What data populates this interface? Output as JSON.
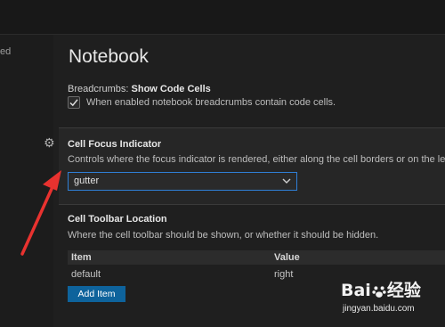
{
  "sidebar": {
    "partial_text": "ed"
  },
  "section": {
    "heading": "Notebook"
  },
  "breadcrumbs": {
    "prefix": "Breadcrumbs: ",
    "name": "Show Code Cells",
    "checked": true,
    "description": "When enabled notebook breadcrumbs contain code cells."
  },
  "cell_focus": {
    "title": "Cell Focus Indicator",
    "description": "Controls where the focus indicator is rendered, either along the cell borders or on the left gu",
    "selected_value": "gutter",
    "gear_icon": "gear-icon"
  },
  "cell_toolbar": {
    "title": "Cell Toolbar Location",
    "description": "Where the cell toolbar should be shown, or whether it should be hidden.",
    "columns": [
      "Item",
      "Value"
    ],
    "rows": [
      {
        "item": "default",
        "value": "right"
      }
    ],
    "add_button": "Add Item"
  },
  "annotation": {
    "arrow_color": "#e8322f"
  },
  "watermark": {
    "brand": "Bai",
    "brand_suffix": "经验",
    "url": "jingyan.baidu.com"
  }
}
